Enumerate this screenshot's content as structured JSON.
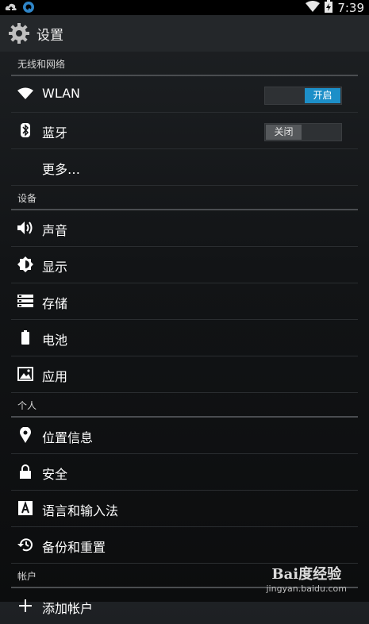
{
  "statusbar": {
    "time": "7:39"
  },
  "header": {
    "title": "设置"
  },
  "sections": [
    {
      "title": "无线和网络",
      "items": [
        {
          "label": "WLAN",
          "icon": "wifi-icon",
          "toggle_label": "开启",
          "toggle_state": "on"
        },
        {
          "label": "蓝牙",
          "icon": "bluetooth-icon",
          "toggle_label": "关闭",
          "toggle_state": "off"
        },
        {
          "label": "更多…"
        }
      ]
    },
    {
      "title": "设备",
      "items": [
        {
          "label": "声音",
          "icon": "volume-icon"
        },
        {
          "label": "显示",
          "icon": "brightness-icon"
        },
        {
          "label": "存储",
          "icon": "storage-icon"
        },
        {
          "label": "电池",
          "icon": "battery-icon"
        },
        {
          "label": "应用",
          "icon": "apps-icon"
        }
      ]
    },
    {
      "title": "个人",
      "items": [
        {
          "label": "位置信息",
          "icon": "location-icon"
        },
        {
          "label": "安全",
          "icon": "lock-icon"
        },
        {
          "label": "语言和输入法",
          "icon": "language-icon"
        },
        {
          "label": "备份和重置",
          "icon": "backup-icon"
        }
      ]
    },
    {
      "title": "帐户",
      "items": [
        {
          "label": "添加帐户",
          "icon": "add-icon"
        }
      ]
    }
  ],
  "watermark": {
    "brand": "Bai度经验",
    "url": "jingyan.baidu.com"
  },
  "colors": {
    "accent": "#1d8fc8",
    "background": "#121416"
  }
}
